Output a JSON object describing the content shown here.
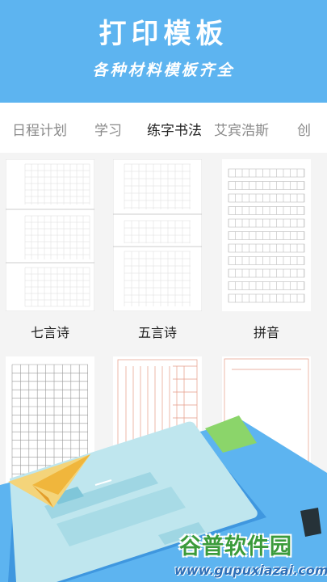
{
  "header": {
    "title": "打印模板",
    "subtitle": "各种材料模板齐全"
  },
  "tabs": [
    {
      "label": "日程计划",
      "active": false
    },
    {
      "label": "学习",
      "active": false
    },
    {
      "label": "练字书法",
      "active": true
    },
    {
      "label": "艾宾浩斯",
      "active": false
    },
    {
      "label": "创",
      "active": false
    }
  ],
  "templates": [
    {
      "label": "七言诗"
    },
    {
      "label": "五言诗"
    },
    {
      "label": "拼音"
    },
    {
      "label": ""
    },
    {
      "label": ""
    },
    {
      "label": ""
    }
  ],
  "watermark": {
    "name": "谷普软件园",
    "url": "www.gupuxiazai.com"
  },
  "colors": {
    "header_bg": "#5db4f0",
    "tab_active": "#222222",
    "tab_inactive": "#8a8a8a",
    "grid_gray": "#cfcfcf",
    "grid_red": "#e59a86"
  }
}
